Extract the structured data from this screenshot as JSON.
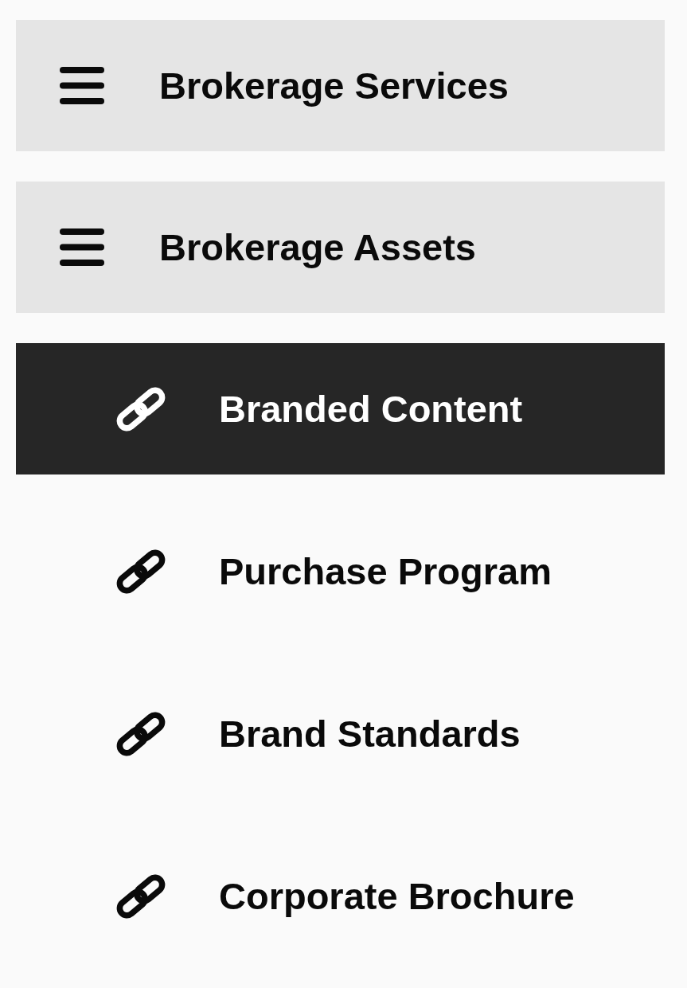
{
  "menu": [
    {
      "label": "Brokerage Services"
    },
    {
      "label": "Brokerage Assets",
      "children": [
        {
          "label": "Branded Content",
          "selected": true
        },
        {
          "label": "Purchase Program",
          "selected": false
        },
        {
          "label": "Brand Standards",
          "selected": false
        },
        {
          "label": "Corporate Brochure",
          "selected": false
        }
      ]
    }
  ]
}
